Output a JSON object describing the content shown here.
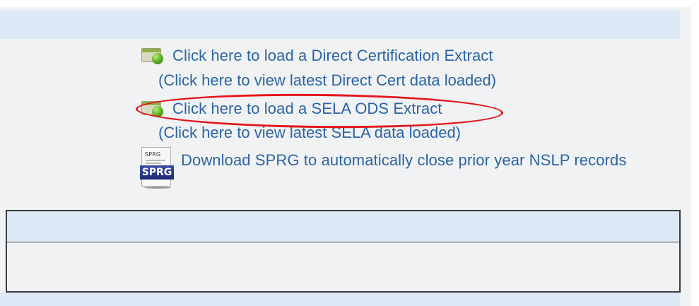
{
  "links": {
    "direct_cert_load": "Click here to load a Direct Certification Extract",
    "direct_cert_view": "(Click here to view latest Direct Cert data loaded)",
    "sela_load": "Click here to load a SELA ODS Extract",
    "sela_view": "(Click here to view latest SELA data loaded)",
    "sprg_download": "Download SPRG to automatically close prior year NSLP records"
  },
  "icons": {
    "load_icon": "load-extract-icon",
    "sprg_icon": "sprg-file-icon",
    "sprg_label": "SPRG",
    "sprg_mini_text": "SPRG"
  },
  "colors": {
    "link": "#2b64a8",
    "highlight": "#e3161c",
    "band": "#dde9f6",
    "panel": "#f1f2f3"
  }
}
